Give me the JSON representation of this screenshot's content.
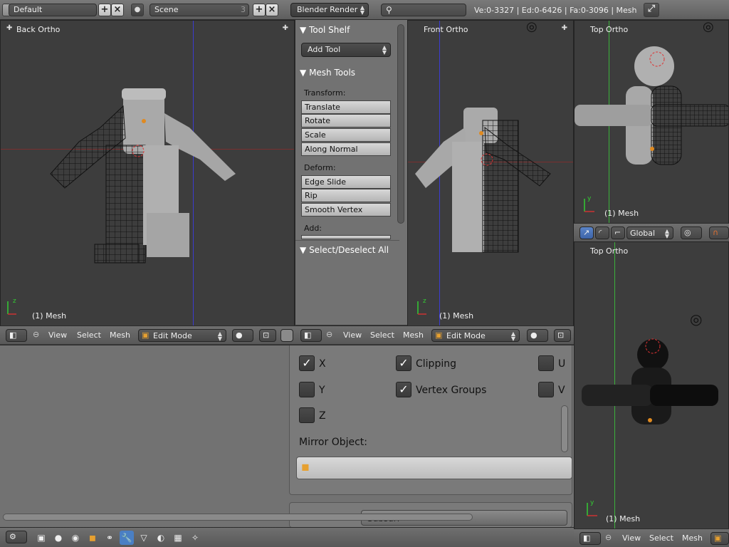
{
  "topbar": {
    "layout_value": "Default",
    "scene_value": "Scene",
    "scene_users": "3",
    "engine": "Blender Render",
    "stats": "Ve:0-3327 | Ed:0-6426 | Fa:0-3096 | Mesh"
  },
  "viewports": {
    "back": {
      "title": "Back Ortho",
      "mesh": "(1) Mesh"
    },
    "front": {
      "title": "Front Ortho",
      "mesh": "(1) Mesh"
    },
    "top1": {
      "title": "Top Ortho",
      "mesh": "(1) Mesh"
    },
    "top2": {
      "title": "Top Ortho",
      "mesh": "(1) Mesh"
    }
  },
  "toolshelf": {
    "title": "Tool Shelf",
    "add_tool": "Add Tool",
    "mesh_tools": "Mesh Tools",
    "transform_label": "Transform:",
    "transform": [
      "Translate",
      "Rotate",
      "Scale",
      "Along Normal"
    ],
    "deform_label": "Deform:",
    "deform": [
      "Edge Slide",
      "Rip",
      "Smooth Vertex"
    ],
    "add_label": "Add:",
    "select_panel": "Select/Deselect All"
  },
  "vheader": {
    "view": "View",
    "select": "Select",
    "mesh": "Mesh",
    "mode": "Edit Mode",
    "orientation": "Global"
  },
  "mirror": {
    "x": "X",
    "y": "Y",
    "z": "Z",
    "x_checked": true,
    "y_checked": false,
    "z_checked": false,
    "clipping": "Clipping",
    "clipping_checked": true,
    "vertex_groups": "Vertex Groups",
    "vertex_groups_checked": true,
    "u": "U",
    "v": "V",
    "mirror_object_label": "Mirror Object:",
    "subsurf_partial": "Subsurf"
  },
  "colors": {
    "accent_blue": "#4a7fc4",
    "axis_red": "#c33",
    "axis_green": "#3c3",
    "axis_blue": "#33c"
  }
}
